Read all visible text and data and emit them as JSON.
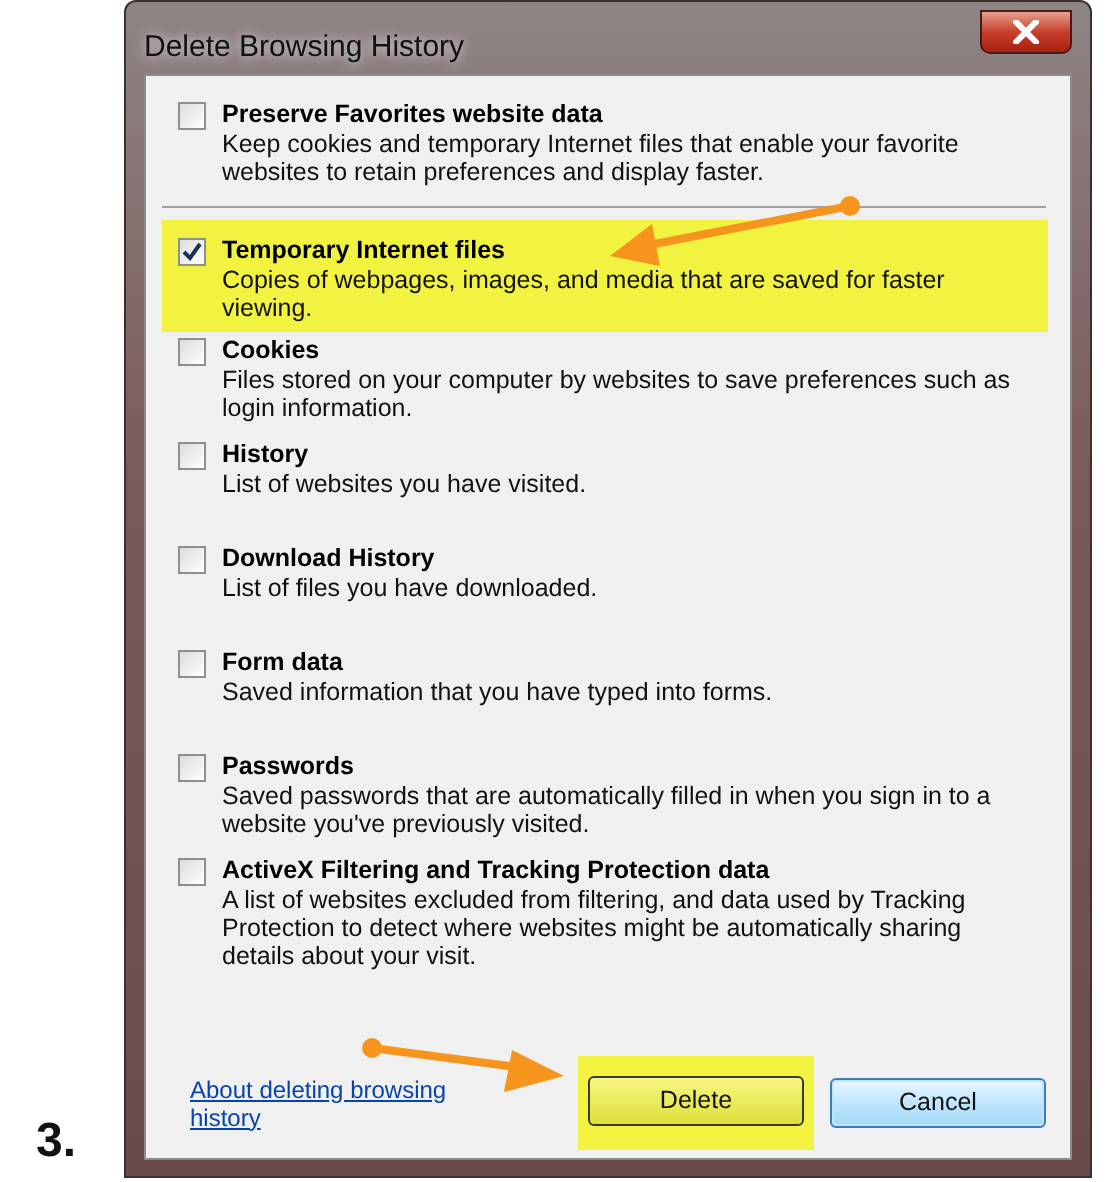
{
  "step_label": "3.",
  "window": {
    "title": "Delete Browsing History"
  },
  "options": [
    {
      "title": "Preserve Favorites website data",
      "description": "Keep cookies and temporary Internet files that enable your favorite websites to retain preferences and display faster.",
      "checked": false,
      "highlighted": false,
      "divider_after": true
    },
    {
      "title": "Temporary Internet files",
      "description": "Copies of webpages, images, and media that are saved for faster viewing.",
      "checked": true,
      "highlighted": true,
      "divider_after": false
    },
    {
      "title": "Cookies",
      "description": "Files stored on your computer by websites to save preferences such as login information.",
      "checked": false,
      "highlighted": false,
      "divider_after": false
    },
    {
      "title": "History",
      "description": "List of websites you have visited.",
      "checked": false,
      "highlighted": false,
      "divider_after": false
    },
    {
      "title": "Download History",
      "description": "List of files you have downloaded.",
      "checked": false,
      "highlighted": false,
      "divider_after": false
    },
    {
      "title": "Form data",
      "description": "Saved information that you have typed into forms.",
      "checked": false,
      "highlighted": false,
      "divider_after": false
    },
    {
      "title": "Passwords",
      "description": "Saved passwords that are automatically filled in when you sign in to a website you've previously visited.",
      "checked": false,
      "highlighted": false,
      "divider_after": false
    },
    {
      "title": "ActiveX Filtering and Tracking Protection data",
      "description": "A list of websites excluded from filtering, and data used by Tracking Protection to detect where websites might be automatically sharing details about your visit.",
      "checked": false,
      "highlighted": false,
      "divider_after": false
    }
  ],
  "link": "About deleting browsing history",
  "buttons": [
    {
      "label": "Delete",
      "kind": "default",
      "highlighted": true
    },
    {
      "label": "Cancel",
      "kind": "focused",
      "highlighted": false
    }
  ]
}
